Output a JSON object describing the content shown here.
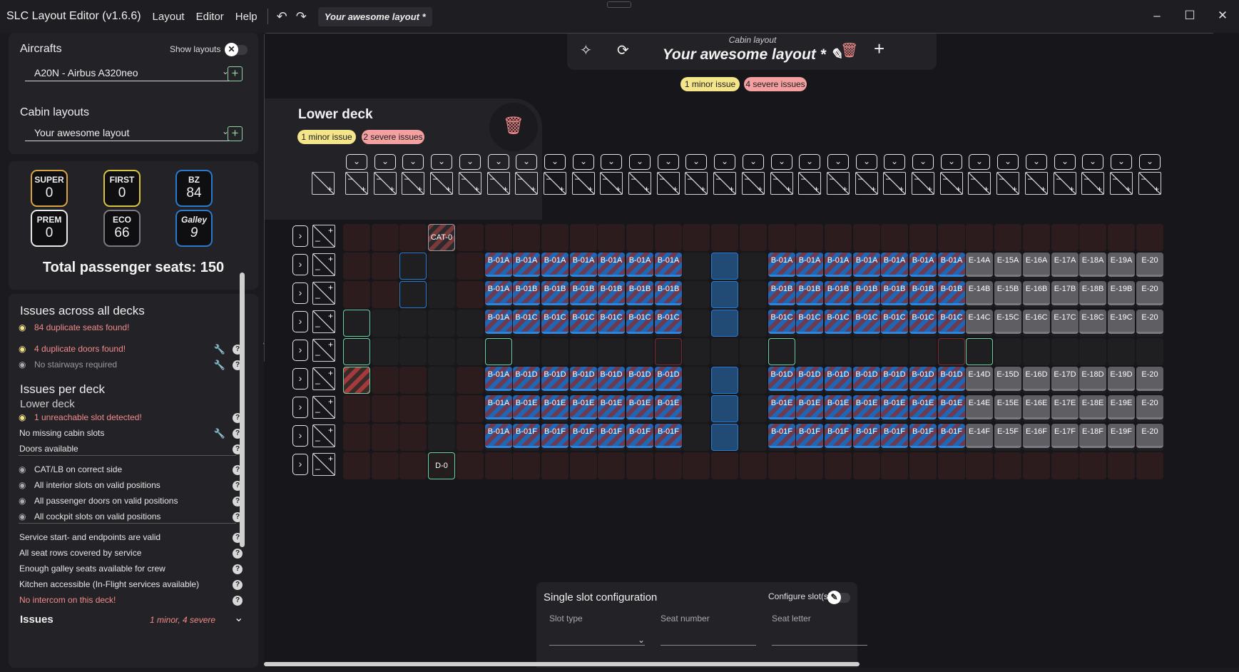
{
  "window": {
    "app_title": "SLC Layout Editor (v1.6.6)",
    "menus": [
      "Layout",
      "Editor",
      "Help"
    ],
    "tab_title": "Your awesome layout *",
    "controls": [
      "–",
      "☐",
      "✕"
    ]
  },
  "aircrafts": {
    "title": "Aircrafts",
    "show_layouts": "Show layouts",
    "selected": "A20N - Airbus A320neo"
  },
  "cabin_layouts": {
    "title": "Cabin layouts",
    "selected": "Your awesome layout"
  },
  "counts": [
    {
      "label": "SUPER",
      "value": "0",
      "color": "#d9a441"
    },
    {
      "label": "FIRST",
      "value": "0",
      "color": "#d9c441"
    },
    {
      "label": "BZ",
      "value": "84",
      "color": "#2a7bd0"
    },
    {
      "label": "PREM",
      "value": "0",
      "color": "#e8e8e8"
    },
    {
      "label": "ECO",
      "value": "66",
      "color": "#7a7a80"
    },
    {
      "label": "Galley",
      "value": "9",
      "color": "#2a7bd0"
    }
  ],
  "total_seats": "Total passenger seats: 150",
  "issues": {
    "all_title": "Issues across all decks",
    "all": [
      {
        "text": "84 duplicate seats found!",
        "severe": true
      },
      {
        "text": "4 duplicate doors found!",
        "severe": true
      },
      {
        "text": "No stairways required",
        "severe": false
      }
    ],
    "per_deck_title": "Issues per deck",
    "deck_name": "Lower deck",
    "deck": [
      "1 unreachable slot detected!",
      "No missing cabin slots",
      "Doors available",
      "CAT/LB on correct side",
      "All interior slots on valid positions",
      "All passenger doors on valid positions",
      "All cockpit slots on valid positions",
      "Service start- and endpoints are valid",
      "All seat rows covered by service",
      "Enough galley seats available for crew",
      "Kitchen accessible (In-Flight services available)",
      "No intercom on this deck!"
    ],
    "footer_title": "Issues",
    "footer_summary": "1 minor, 4 severe"
  },
  "cabin": {
    "label": "Cabin layout",
    "name": "Your awesome layout *",
    "minor": "1 minor issue",
    "severe": "4 severe issues"
  },
  "deck": {
    "name": "Lower deck",
    "minor": "1 minor issue",
    "severe": "2 severe issues"
  },
  "grid": {
    "cat": "CAT-0",
    "door": "D-0",
    "rows": [
      [
        "B-01A",
        "B-01A",
        "B-01A",
        "B-01A",
        "B-01A",
        "B-01A",
        "B-01A"
      ],
      [
        "B-01A",
        "B-01B",
        "B-01B",
        "B-01B",
        "B-01B",
        "B-01B",
        "B-01B"
      ],
      [
        "B-01A",
        "B-01C",
        "B-01C",
        "B-01C",
        "B-01C",
        "B-01C",
        "B-01C"
      ],
      [
        "B-01A",
        "B-01D",
        "B-01D",
        "B-01D",
        "B-01D",
        "B-01D",
        "B-01D"
      ],
      [
        "B-01A",
        "B-01E",
        "B-01E",
        "B-01E",
        "B-01E",
        "B-01E",
        "B-01E"
      ],
      [
        "B-01A",
        "B-01F",
        "B-01F",
        "B-01F",
        "B-01F",
        "B-01F",
        "B-01F"
      ]
    ],
    "rows_right": [
      [
        "B-01A",
        "B-01A",
        "B-01A",
        "B-01A",
        "B-01A",
        "B-01A",
        "B-01A"
      ],
      [
        "B-01B",
        "B-01B",
        "B-01B",
        "B-01B",
        "B-01B",
        "B-01B",
        "B-01B"
      ],
      [
        "B-01C",
        "B-01C",
        "B-01C",
        "B-01C",
        "B-01C",
        "B-01C",
        "B-01C"
      ],
      [
        "B-01D",
        "B-01D",
        "B-01D",
        "B-01D",
        "B-01D",
        "B-01D",
        "B-01D"
      ],
      [
        "B-01E",
        "B-01E",
        "B-01E",
        "B-01E",
        "B-01E",
        "B-01E",
        "B-01E"
      ],
      [
        "B-01F",
        "B-01F",
        "B-01F",
        "B-01F",
        "B-01F",
        "B-01F",
        "B-01F"
      ]
    ],
    "eco_rows": [
      [
        "E-14A",
        "E-15A",
        "E-16A",
        "E-17A",
        "E-18A",
        "E-19A",
        "E-20"
      ],
      [
        "E-14B",
        "E-15B",
        "E-16B",
        "E-17B",
        "E-18B",
        "E-19B",
        "E-20"
      ],
      [
        "E-14C",
        "E-15C",
        "E-16C",
        "E-17C",
        "E-18C",
        "E-19C",
        "E-20"
      ],
      [
        "E-14D",
        "E-15D",
        "E-16D",
        "E-17D",
        "E-18D",
        "E-19D",
        "E-20"
      ],
      [
        "E-14E",
        "E-15E",
        "E-16E",
        "E-17E",
        "E-18E",
        "E-19E",
        "E-20"
      ],
      [
        "E-14F",
        "E-15F",
        "E-16F",
        "E-17F",
        "E-18F",
        "E-19F",
        "E-20"
      ]
    ]
  },
  "slot_config": {
    "title": "Single slot configuration",
    "configure": "Configure slot(s)",
    "fields": [
      "Slot type",
      "Seat number",
      "Seat letter"
    ]
  }
}
